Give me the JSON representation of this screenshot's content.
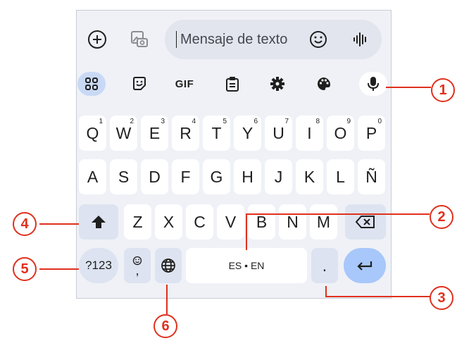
{
  "compose": {
    "placeholder": "Mensaje de texto"
  },
  "toolbar": {
    "gif_label": "GIF"
  },
  "keyboard": {
    "row1": [
      {
        "label": "Q",
        "hint": "1"
      },
      {
        "label": "W",
        "hint": "2"
      },
      {
        "label": "E",
        "hint": "3"
      },
      {
        "label": "R",
        "hint": "4"
      },
      {
        "label": "T",
        "hint": "5"
      },
      {
        "label": "Y",
        "hint": "6"
      },
      {
        "label": "U",
        "hint": "7"
      },
      {
        "label": "I",
        "hint": "8"
      },
      {
        "label": "O",
        "hint": "9"
      },
      {
        "label": "P",
        "hint": "0"
      }
    ],
    "row2": [
      "A",
      "S",
      "D",
      "F",
      "G",
      "H",
      "J",
      "K",
      "L",
      "Ñ"
    ],
    "row3": [
      "Z",
      "X",
      "C",
      "V",
      "B",
      "N",
      "M"
    ],
    "symbols_label": "?123",
    "emoji_comma_label": ",",
    "space_label": "ES • EN",
    "period_label": "."
  },
  "callouts": [
    "1",
    "2",
    "3",
    "4",
    "5",
    "6"
  ],
  "colors": {
    "callout": "#e0301e",
    "accent": "#a8c7fa",
    "panel": "#eff1f7"
  }
}
